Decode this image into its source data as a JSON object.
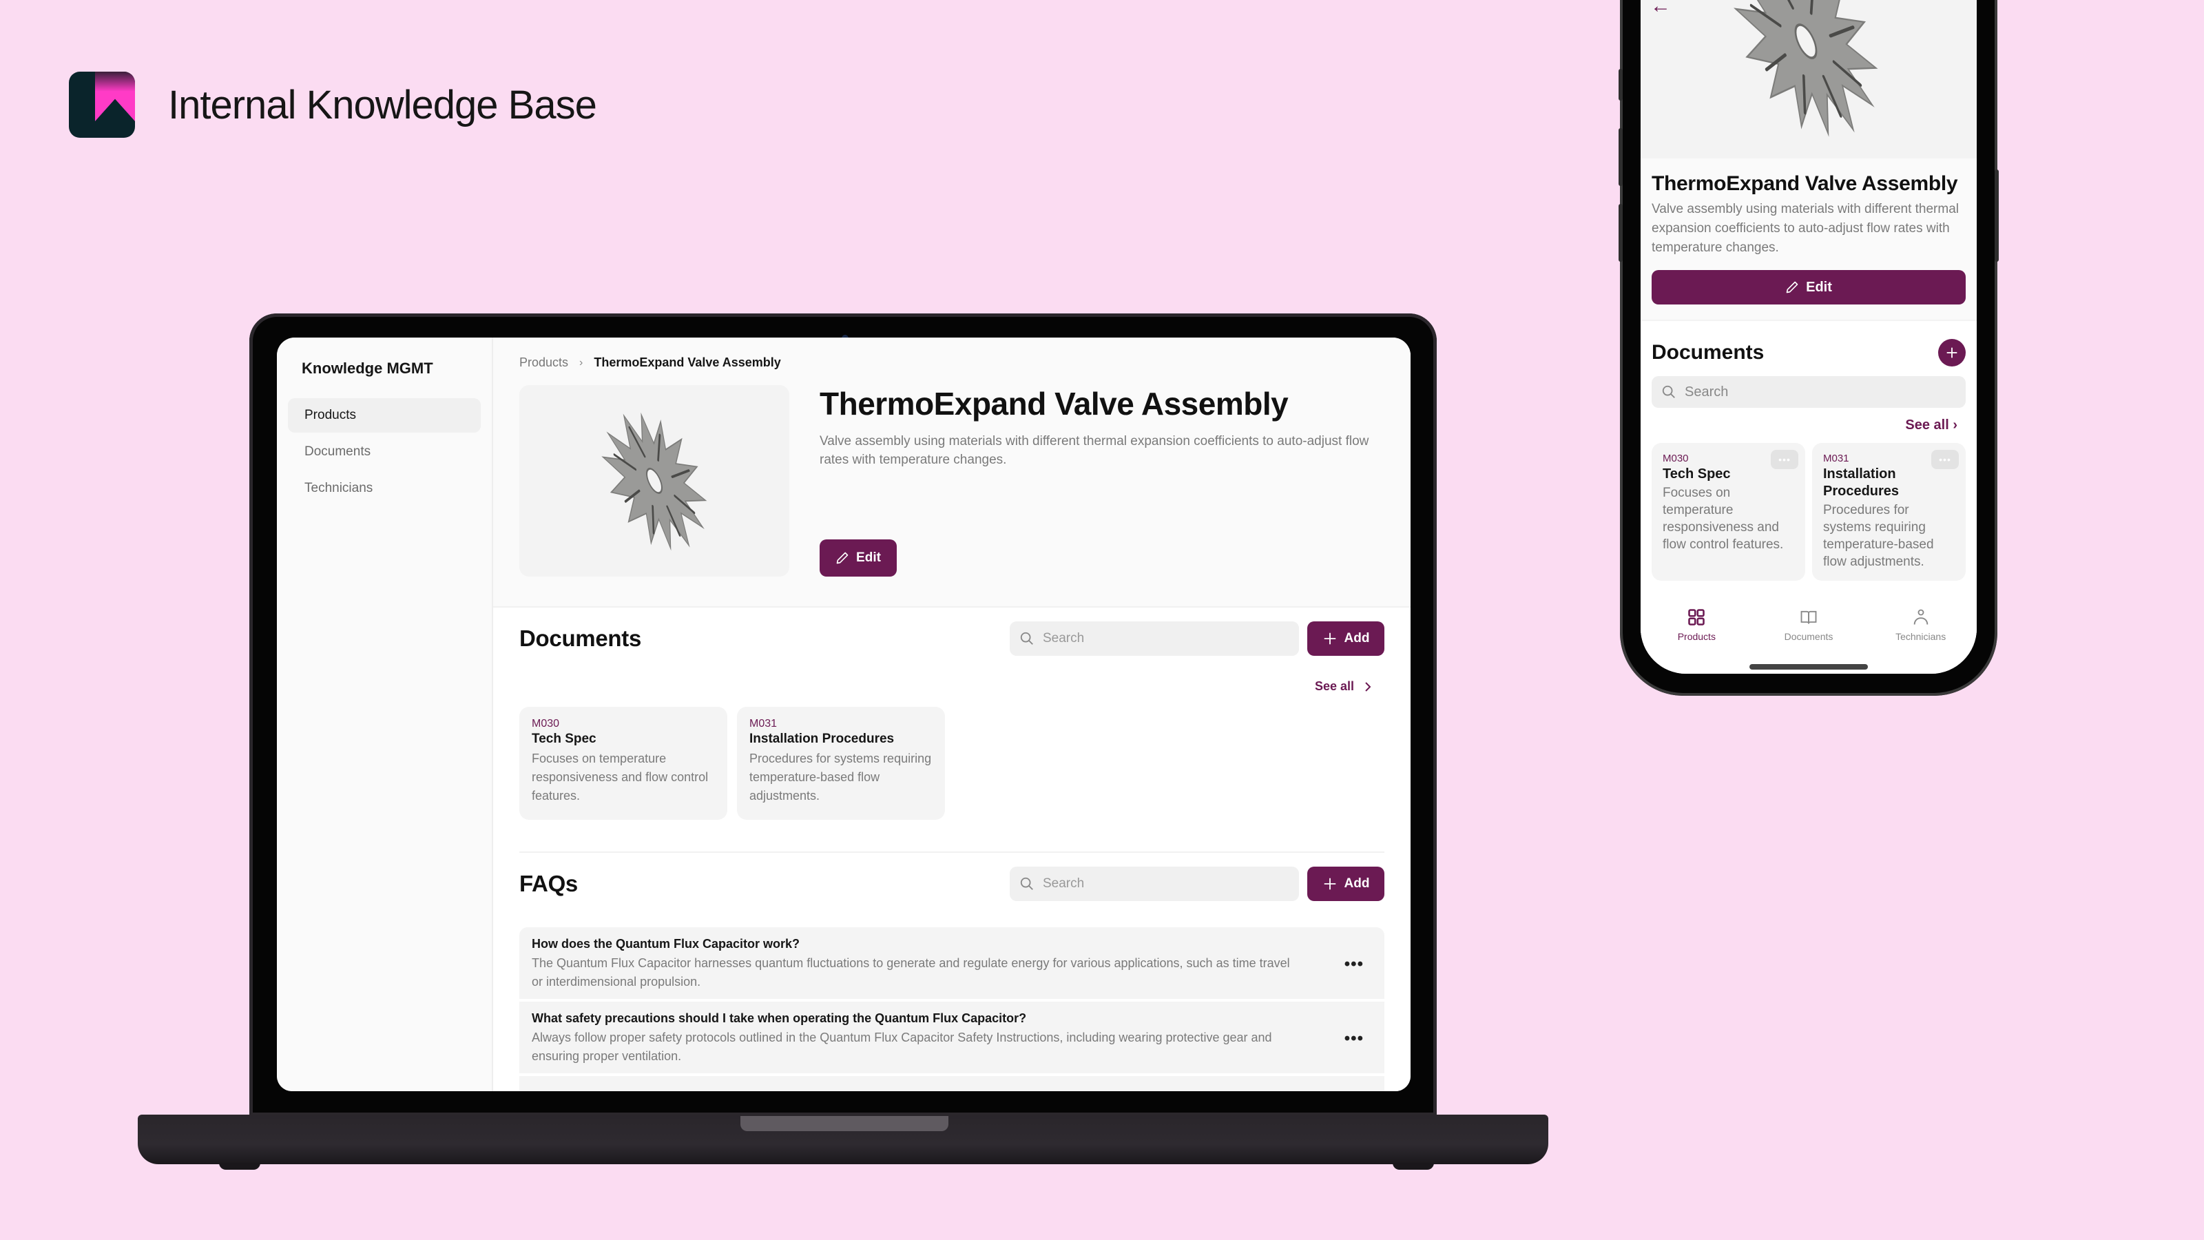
{
  "brand": {
    "title": "Internal Knowledge Base",
    "accent": "#ff3bc6",
    "logo_bg": "#0a242b"
  },
  "theme": {
    "primary": "#6b1a53",
    "background": "#fbdcf2"
  },
  "desktop": {
    "sidebar": {
      "title": "Knowledge MGMT",
      "items": [
        {
          "label": "Products",
          "active": true
        },
        {
          "label": "Documents",
          "active": false
        },
        {
          "label": "Technicians",
          "active": false
        }
      ]
    },
    "breadcrumb": {
      "parent": "Products",
      "separator": "›",
      "current": "ThermoExpand Valve Assembly"
    },
    "product": {
      "title": "ThermoExpand Valve Assembly",
      "description": "Valve assembly using materials with different thermal expansion coefficients to auto-adjust flow rates with temperature changes.",
      "image_icon": "gear-valve-image",
      "edit_label": "Edit"
    },
    "documents": {
      "title": "Documents",
      "search_placeholder": "Search",
      "add_label": "Add",
      "see_all_label": "See all",
      "items": [
        {
          "code": "M030",
          "name": "Tech Spec",
          "description": "Focuses on temperature responsiveness and flow control features."
        },
        {
          "code": "M031",
          "name": "Installation Procedures",
          "description": "Procedures for systems requiring temperature-based flow adjustments."
        }
      ]
    },
    "faqs": {
      "title": "FAQs",
      "search_placeholder": "Search",
      "add_label": "Add",
      "more_label": "•••",
      "items": [
        {
          "question": "How does the Quantum Flux Capacitor work?",
          "answer": "The Quantum Flux Capacitor harnesses quantum fluctuations to generate and regulate energy for various applications, such as time travel or interdimensional propulsion."
        },
        {
          "question": "What safety precautions should I take when operating the Quantum Flux Capacitor?",
          "answer": "Always follow proper safety protocols outlined in the Quantum Flux Capacitor Safety Instructions, including wearing protective gear and ensuring proper ventilation."
        }
      ]
    }
  },
  "mobile": {
    "back_icon": "←",
    "product": {
      "title": "ThermoExpand Valve Assembly",
      "description": "Valve assembly using materials with different thermal expansion coefficients to auto-adjust flow rates with temperature changes.",
      "edit_label": "Edit"
    },
    "documents": {
      "title": "Documents",
      "search_placeholder": "Search",
      "see_all_label": "See all ›",
      "more_label": "•••",
      "items": [
        {
          "code": "M030",
          "name": "Tech Spec",
          "description": "Focuses on temperature responsiveness and flow control features."
        },
        {
          "code": "M031",
          "name": "Installation Procedures",
          "description": "Procedures for systems requiring temperature-based flow adjustments."
        }
      ]
    },
    "tabbar": [
      {
        "label": "Products",
        "icon": "grid-icon",
        "active": true
      },
      {
        "label": "Documents",
        "icon": "book-icon",
        "active": false
      },
      {
        "label": "Technicians",
        "icon": "person-icon",
        "active": false
      }
    ]
  }
}
